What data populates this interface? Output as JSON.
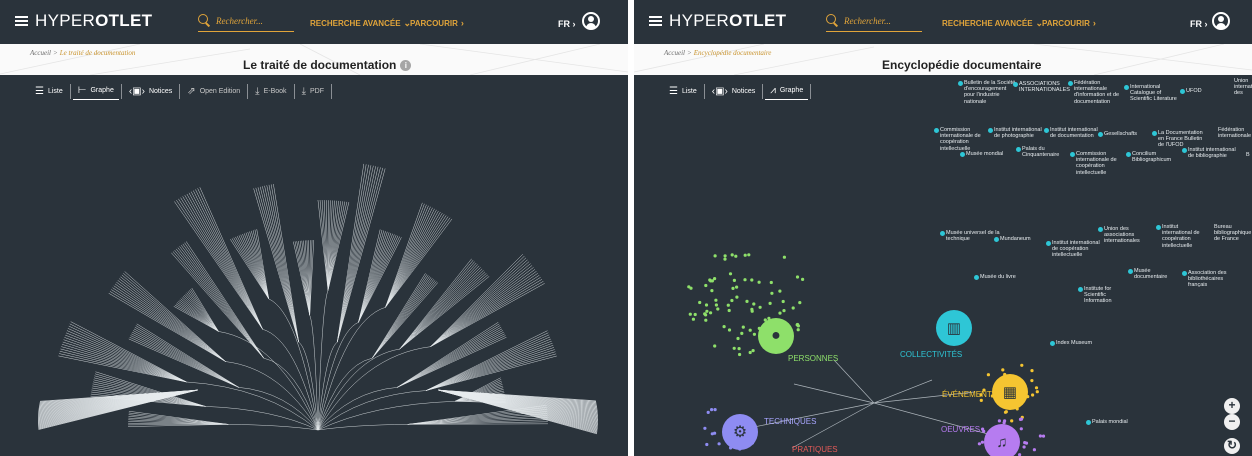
{
  "header": {
    "logo_light": "HYPER",
    "logo_bold": "OTLET",
    "search_placeholder": "Rechercher...",
    "advanced_search_label": "RECHERCHE AVANCÉE",
    "browse_label": "PARCOURIR",
    "language": "FR",
    "accent_color": "#e0a43a"
  },
  "left": {
    "breadcrumb": {
      "home": "Accueil",
      "current": "Le traité de documentation"
    },
    "title": "Le traité de documentation",
    "toolbar": {
      "list": "Liste",
      "graph": "Graphe",
      "notices": "Notices",
      "openedition": "Open Edition",
      "ebook": "E-Book",
      "pdf": "PDF"
    }
  },
  "right": {
    "breadcrumb": {
      "home": "Accueil",
      "current": "Encyclopédie documentaire"
    },
    "title": "Encyclopédie documentaire",
    "toolbar": {
      "list": "Liste",
      "notices": "Notices",
      "graph": "Graphe"
    },
    "hubs": {
      "persons": "PERSONNES",
      "collectivities": "COLLECTIVITÉS",
      "events": "ÉVÉNEMENTS",
      "techniques": "TECHNIQUES",
      "works": "OEUVRES",
      "practices": "PRATIQUES"
    },
    "nodes": [
      "Bulletin de la Société d'encouragement pour l'industrie nationale",
      "ASSOCIATIONS INTERNATIONALES",
      "Fédération internationale d'information et de documentation",
      "International Catalogue of Scientific Literature",
      "UFOD",
      "Union internationale des",
      "Commission internationale de coopération intellectuelle",
      "Institut international de photographie",
      "Institut international de documentation",
      "Gesellschafts",
      "La Documentation en France Bulletin de l'UFOD",
      "Fédération internationale",
      "Musée mondial",
      "Palais du Cinquantenaire",
      "Commission internationale de coopération intellectuelle",
      "Concilium Bibliographicum",
      "Institut international de bibliographie",
      "B",
      "Musée universel de la technique",
      "Mundaneum",
      "Institut international de coopération intellectuelle",
      "Union des associations internationales",
      "Institut international de coopération intellectuelle",
      "Bureau bibliographique de France",
      "Musée du livre",
      "Musée documentaire",
      "Association des bibliothécaires français",
      "Institute for Scientific Information",
      "Index Museum",
      "Palais mondial"
    ],
    "colors": {
      "persons": "#8ee06a",
      "collectivities": "#2ec6d6",
      "events": "#f5c531",
      "techniques": "#8e8cf2",
      "works": "#b67cf0",
      "practices": "#e45a58"
    }
  }
}
